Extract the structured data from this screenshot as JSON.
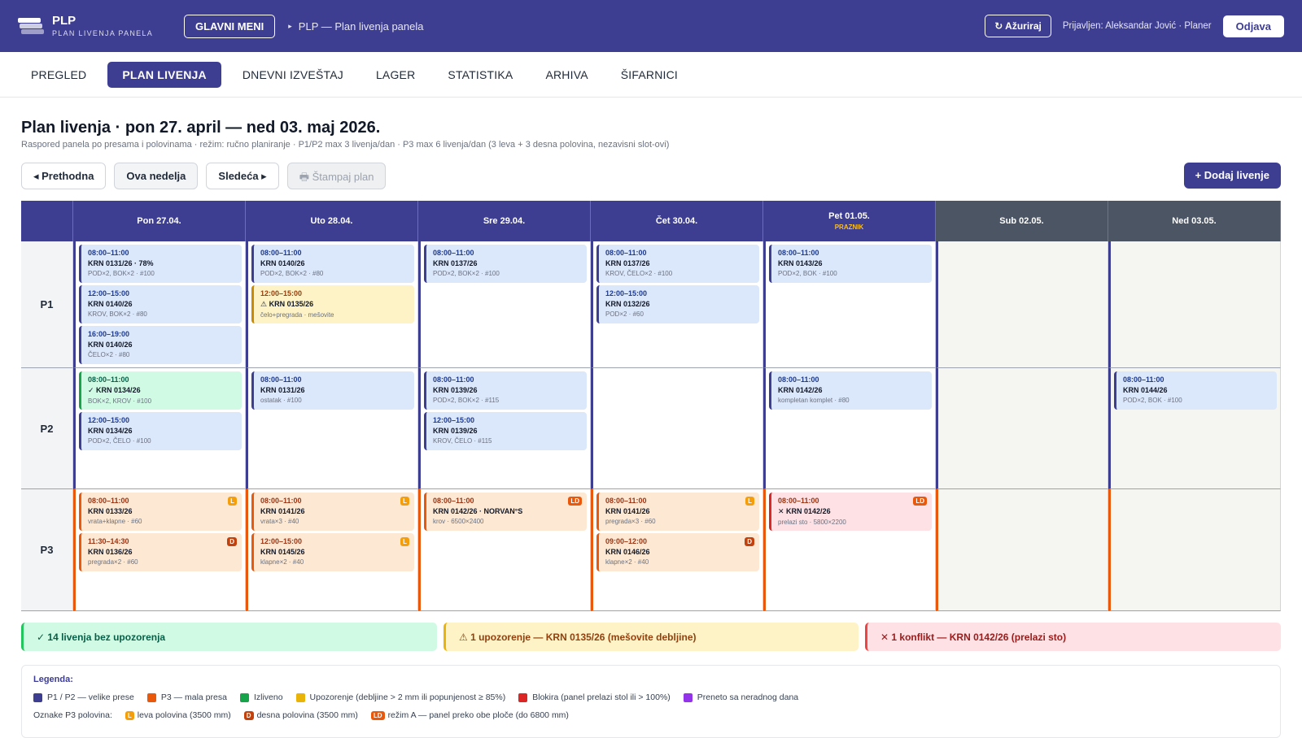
{
  "header": {
    "app_title": "PLP",
    "app_subtitle": "PLAN LIVENJA PANELA",
    "main_menu": "GLAVNI MENI",
    "breadcrumb": "PLP — Plan livenja panela",
    "refresh": "↻ Ažuriraj",
    "user": "Prijavljen: Aleksandar Jović · Planer",
    "logout": "Odjava"
  },
  "tabs": [
    "PREGLED",
    "PLAN LIVENJA",
    "DNEVNI IZVEŠTAJ",
    "LAGER",
    "STATISTIKA",
    "ARHIVA",
    "ŠIFARNICI"
  ],
  "active_tab": 1,
  "page": {
    "title": "Plan livenja · pon 27. april — ned 03. maj 2026.",
    "subtitle": "Raspored panela po presama i polovinama · režim: ručno planiranje · P1/P2 max 3 livenja/dan · P3 max 6 livenja/dan (3 leva + 3 desna polovina, nezavisni slot-ovi)"
  },
  "toolbar": {
    "prev": "◂ Prethodna",
    "current": "Ova nedelja",
    "next": "Sledeća ▸",
    "print": "🖶 Štampaj plan",
    "add": "+ Dodaj livenje"
  },
  "days": [
    {
      "label": "Pon 27.04.",
      "note": "",
      "weekend": false
    },
    {
      "label": "Uto 28.04.",
      "note": "",
      "weekend": false
    },
    {
      "label": "Sre 29.04.",
      "note": "",
      "weekend": false
    },
    {
      "label": "Čet 30.04.",
      "note": "",
      "weekend": false
    },
    {
      "label": "Pet 01.05.",
      "note": "PRAZNIK",
      "weekend": false
    },
    {
      "label": "Sub 02.05.",
      "note": "",
      "weekend": true
    },
    {
      "label": "Ned 03.05.",
      "note": "",
      "weekend": true
    }
  ],
  "rows": [
    {
      "press": "P1",
      "type": "p12",
      "cells": [
        [
          {
            "time": "08:00–11:00",
            "name": "KRN 0131/26 · 78%",
            "desc": "POD×2, BOK×2 · #100",
            "status": "blue"
          },
          {
            "time": "12:00–15:00",
            "name": "KRN 0140/26",
            "desc": "KROV, BOK×2 · #80",
            "status": "blue"
          },
          {
            "time": "16:00–19:00",
            "name": "KRN 0140/26",
            "desc": "ČELO×2 · #80",
            "status": "blue"
          }
        ],
        [
          {
            "time": "08:00–11:00",
            "name": "KRN 0140/26",
            "desc": "POD×2, BOK×2 · #80",
            "status": "blue"
          },
          {
            "time": "12:00–15:00",
            "name": "⚠ KRN 0135/26",
            "desc": "čelo+pregrada · mešovite",
            "status": "yellow"
          }
        ],
        [
          {
            "time": "08:00–11:00",
            "name": "KRN 0137/26",
            "desc": "POD×2, BOK×2 · #100",
            "status": "blue"
          }
        ],
        [
          {
            "time": "08:00–11:00",
            "name": "KRN 0137/26",
            "desc": "KROV, ČELO×2 · #100",
            "status": "blue"
          },
          {
            "time": "12:00–15:00",
            "name": "KRN 0132/26",
            "desc": "POD×2 · #60",
            "status": "blue"
          }
        ],
        [
          {
            "time": "08:00–11:00",
            "name": "KRN 0143/26",
            "desc": "POD×2, BOK · #100",
            "status": "blue"
          }
        ],
        [],
        []
      ]
    },
    {
      "press": "P2",
      "type": "p12",
      "cells": [
        [
          {
            "time": "08:00–11:00",
            "name": "✓ KRN 0134/26",
            "desc": "BOK×2, KROV · #100",
            "status": "green"
          },
          {
            "time": "12:00–15:00",
            "name": "KRN 0134/26",
            "desc": "POD×2, ČELO · #100",
            "status": "blue"
          }
        ],
        [
          {
            "time": "08:00–11:00",
            "name": "KRN 0131/26",
            "desc": "ostatak · #100",
            "status": "blue"
          }
        ],
        [
          {
            "time": "08:00–11:00",
            "name": "KRN 0139/26",
            "desc": "POD×2, BOK×2 · #115",
            "status": "blue"
          },
          {
            "time": "12:00–15:00",
            "name": "KRN 0139/26",
            "desc": "KROV, ČELO · #115",
            "status": "blue"
          }
        ],
        [],
        [
          {
            "time": "08:00–11:00",
            "name": "KRN 0142/26",
            "desc": "kompletan komplet · #80",
            "status": "blue"
          }
        ],
        [],
        [
          {
            "time": "08:00–11:00",
            "name": "KRN 0144/26",
            "desc": "POD×2, BOK · #100",
            "status": "blue"
          }
        ]
      ]
    },
    {
      "press": "P3",
      "type": "p3",
      "cells": [
        [
          {
            "time": "08:00–11:00",
            "name": "KRN 0133/26",
            "desc": "vrata+klapne · #60",
            "status": "orange",
            "badge": "L"
          },
          {
            "time": "11:30–14:30",
            "name": "KRN 0136/26",
            "desc": "pregrada×2 · #60",
            "status": "orange",
            "badge": "D"
          }
        ],
        [
          {
            "time": "08:00–11:00",
            "name": "KRN 0141/26",
            "desc": "vrata×3 · #40",
            "status": "orange",
            "badge": "L"
          },
          {
            "time": "12:00–15:00",
            "name": "KRN 0145/26",
            "desc": "klapne×2 · #40",
            "status": "orange",
            "badge": "L"
          }
        ],
        [
          {
            "time": "08:00–11:00",
            "name": "KRN 0142/26 · NORVAN°S",
            "desc": "krov · 6500×2400",
            "status": "orange",
            "badge": "LD"
          }
        ],
        [
          {
            "time": "08:00–11:00",
            "name": "KRN 0141/26",
            "desc": "pregrada×3 · #60",
            "status": "orange",
            "badge": "L"
          },
          {
            "time": "09:00–12:00",
            "name": "KRN 0146/26",
            "desc": "klapne×2 · #40",
            "status": "orange",
            "badge": "D"
          }
        ],
        [
          {
            "time": "08:00–11:00",
            "name": "✕ KRN 0142/26",
            "desc": "prelazi sto · 5800×2200",
            "status": "red",
            "badge": "LD"
          }
        ],
        [],
        []
      ]
    }
  ],
  "status": {
    "ok": "✓  14 livenja bez upozorenja",
    "warn": "⚠  1 upozorenje — KRN 0135/26 (mešovite debljine)",
    "err": "✕  1 konflikt — KRN 0142/26 (prelazi sto)"
  },
  "legend": {
    "title": "Legenda:",
    "items": [
      {
        "label": "P1 / P2 — velike prese",
        "color": "#3d3d91"
      },
      {
        "label": "P3 — mala presa",
        "color": "#ea580c"
      },
      {
        "label": "Izliveno",
        "color": "#16a34a"
      },
      {
        "label": "Upozorenje (debljine > 2 mm ili popunjenost ≥ 85%)",
        "color": "#eab308"
      },
      {
        "label": "Blokira (panel prelazi stol ili > 100%)",
        "color": "#dc2626"
      },
      {
        "label": "Preneto sa neradnog dana",
        "color": "#9333ea"
      }
    ],
    "p3_title": "Oznake P3 polovina:",
    "p3_items": [
      {
        "badge": "L",
        "label": "leva polovina (3500 mm)"
      },
      {
        "badge": "D",
        "label": "desna polovina (3500 mm)"
      },
      {
        "badge": "LD",
        "label": "režim A — panel preko obe ploče (do 6800 mm)"
      }
    ]
  }
}
